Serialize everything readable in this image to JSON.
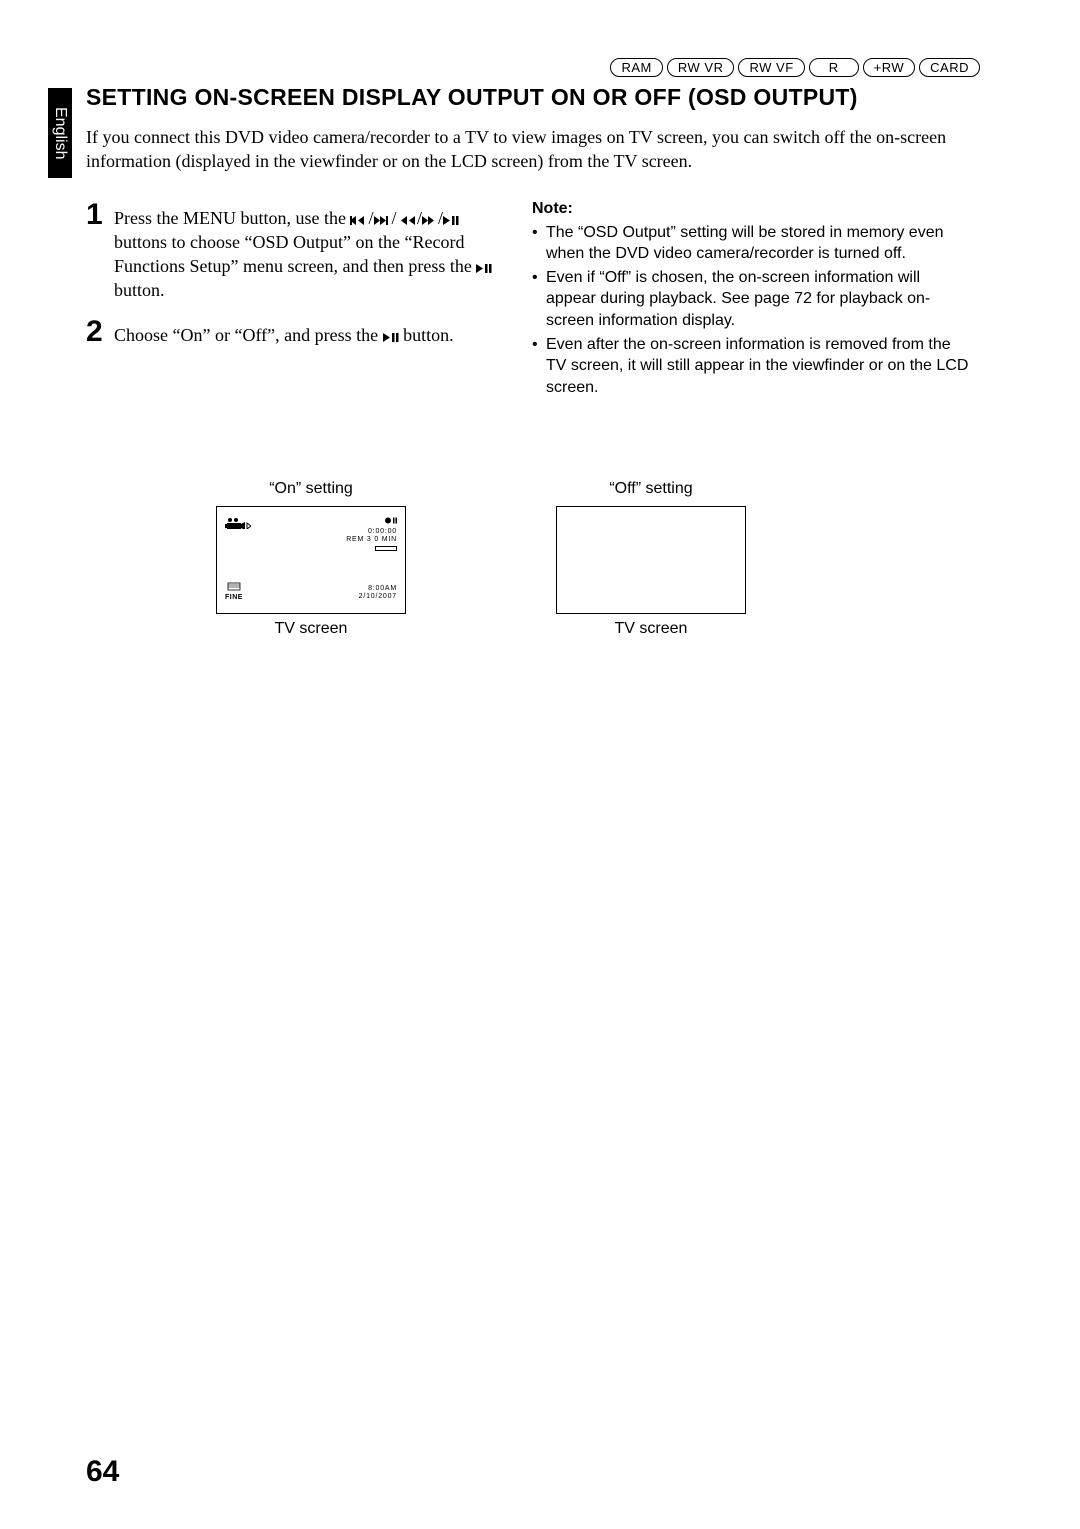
{
  "language": "English",
  "badges": [
    "RAM",
    "RW VR",
    "RW VF",
    "R",
    "+RW",
    "CARD"
  ],
  "title": "SETTING ON-SCREEN DISPLAY OUTPUT ON OR OFF (OSD OUTPUT)",
  "intro": "If you connect this DVD video camera/recorder to a TV to view images on TV screen, you can switch off the on-screen information (displayed in the viewfinder or on the LCD screen) from the TV screen.",
  "steps": [
    {
      "num": "1",
      "pre": "Press the MENU button, use the ",
      "mid1": " buttons to choose “OSD Output” on the “Record Functions Setup” menu screen, and then press the ",
      "post": " button."
    },
    {
      "num": "2",
      "pre": "Choose “On” or “Off”, and press the ",
      "post": " button."
    }
  ],
  "note_hdr": "Note:",
  "notes": [
    "The “OSD Output” setting will be stored in memory even when the DVD video camera/recorder is turned off.",
    "Even if “Off” is chosen, the on-screen information will appear during playback. See page 72 for playback on-screen information display.",
    "Even after the on-screen information is removed from the TV screen, it will still appear in the viewfinder or on the LCD screen."
  ],
  "examples": {
    "on_label": "“On” setting",
    "off_label": "“Off” setting",
    "tv_caption": "TV screen",
    "tv": {
      "top_right_time": "0:00:00",
      "top_right_rem": "REM 3 0 MIN",
      "bottom_left": "FINE",
      "bottom_right_time": "8:00AM",
      "bottom_right_date": "2/10/2007"
    }
  },
  "page_number": "64"
}
